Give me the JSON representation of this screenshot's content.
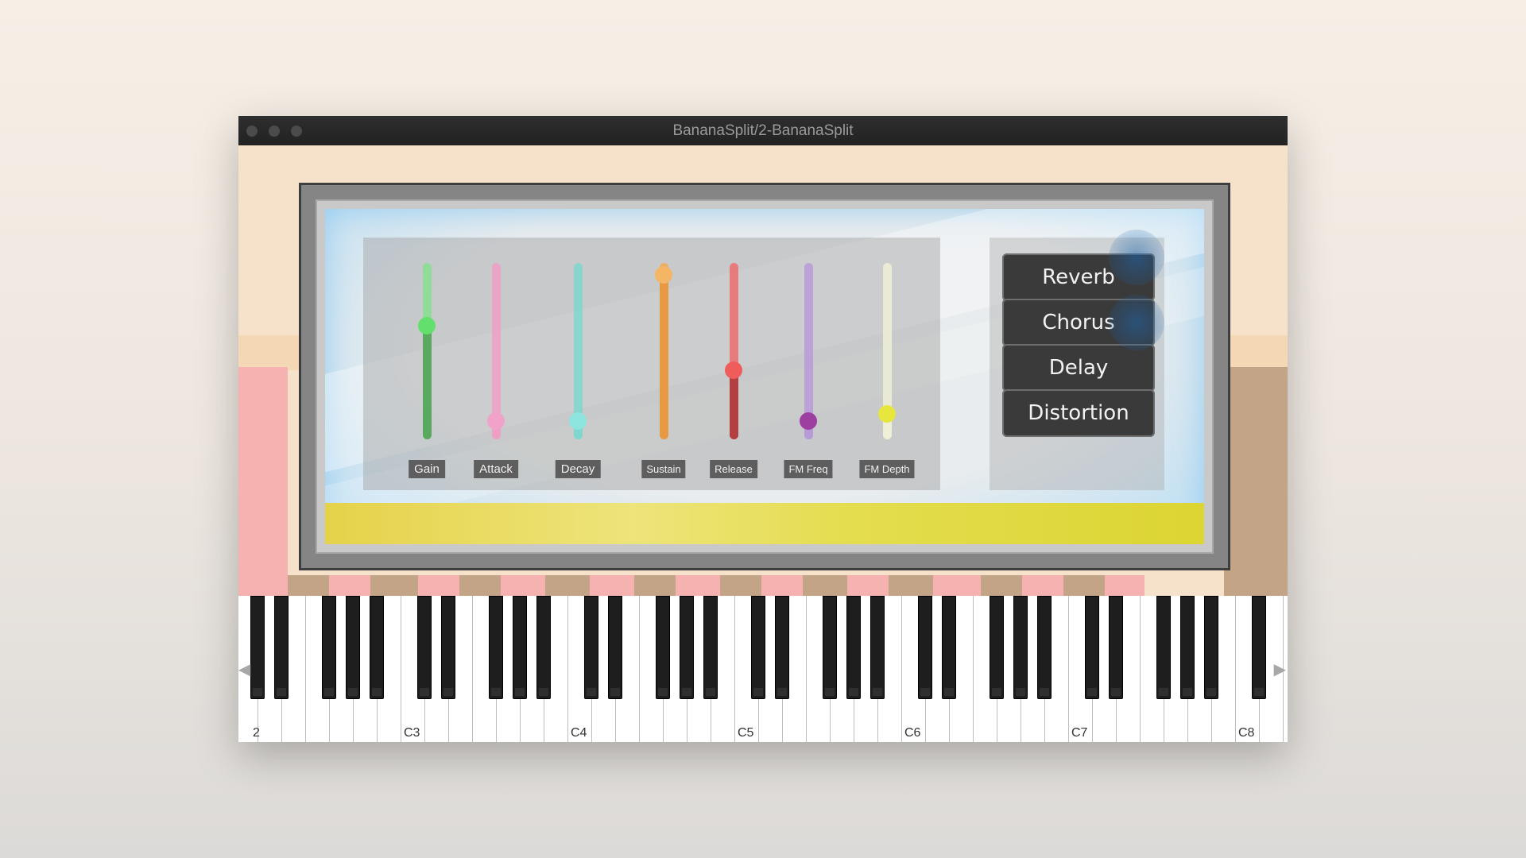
{
  "window": {
    "title": "BananaSplit/2-BananaSplit"
  },
  "sliders": [
    {
      "label": "Gain",
      "value": 0.65,
      "track": "#86df8f",
      "fill": "#5aa95e",
      "thumb": "#62df6c"
    },
    {
      "label": "Attack",
      "value": 0.0,
      "track": "#ee9fc4",
      "fill": "#ee9fc4",
      "thumb": "#f1a2c8"
    },
    {
      "label": "Decay",
      "value": 0.0,
      "track": "#7fd6cf",
      "fill": "#7fd6cf",
      "thumb": "#8ee4de"
    },
    {
      "label": "Sustain",
      "value": 1.0,
      "track": "#f1a953",
      "fill": "#e89a42",
      "thumb": "#f4b565"
    },
    {
      "label": "Release",
      "value": 0.35,
      "track": "#ec6d6e",
      "fill": "#b33f40",
      "thumb": "#ee5c5c"
    },
    {
      "label": "FM Freq",
      "value": 0.0,
      "track": "#b79ad8",
      "fill": "#b79ad8",
      "thumb": "#9c3fa0"
    },
    {
      "label": "FM Depth",
      "value": 0.05,
      "track": "#efeed6",
      "fill": "#efeed6",
      "thumb": "#e7e63c"
    }
  ],
  "effects": [
    "Reverb",
    "Chorus",
    "Delay",
    "Distortion"
  ],
  "keyboard": {
    "octave_labels": [
      "2",
      "C3",
      "C4",
      "C5",
      "C6",
      "C7",
      "C8"
    ],
    "scroll_left": "◀",
    "scroll_right": "▶"
  },
  "colors": {
    "strip_pink": "#f6b2b0",
    "strip_tan": "#c4a486"
  }
}
